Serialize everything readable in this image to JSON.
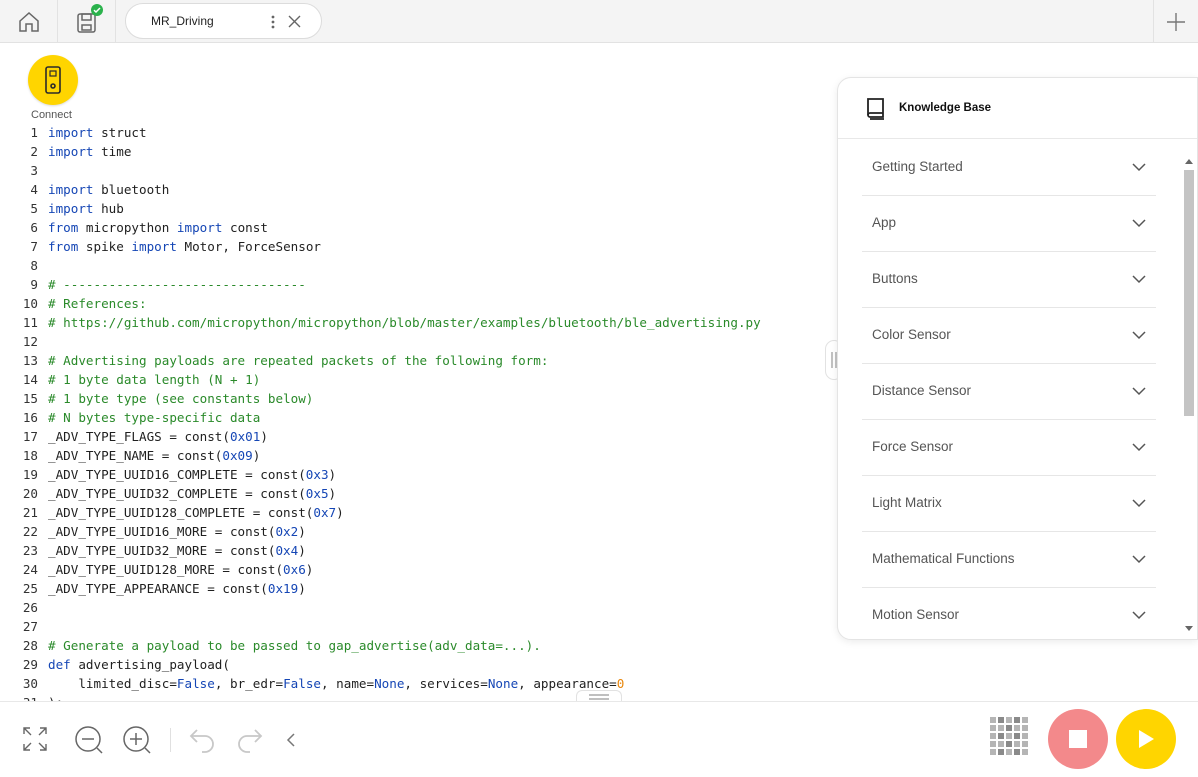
{
  "tab": {
    "title": "MR_Driving"
  },
  "connect": {
    "label": "Connect"
  },
  "code_lines": [
    [
      {
        "t": "import",
        "c": "kw"
      },
      {
        "t": " struct"
      }
    ],
    [
      {
        "t": "import",
        "c": "kw"
      },
      {
        "t": " time"
      }
    ],
    [],
    [
      {
        "t": "import",
        "c": "kw"
      },
      {
        "t": " bluetooth"
      }
    ],
    [
      {
        "t": "import",
        "c": "kw"
      },
      {
        "t": " hub"
      }
    ],
    [
      {
        "t": "from",
        "c": "kw"
      },
      {
        "t": " micropython "
      },
      {
        "t": "import",
        "c": "kw"
      },
      {
        "t": " const"
      }
    ],
    [
      {
        "t": "from",
        "c": "kw"
      },
      {
        "t": " spike "
      },
      {
        "t": "import",
        "c": "kw"
      },
      {
        "t": " Motor, ForceSensor"
      }
    ],
    [],
    [
      {
        "t": "# --------------------------------",
        "c": "cm"
      }
    ],
    [
      {
        "t": "# References:",
        "c": "cm"
      }
    ],
    [
      {
        "t": "# https://github.com/micropython/micropython/blob/master/examples/bluetooth/ble_advertising.py",
        "c": "cm"
      }
    ],
    [],
    [
      {
        "t": "# Advertising payloads are repeated packets of the following form:",
        "c": "cm"
      }
    ],
    [
      {
        "t": "# 1 byte data length (N + 1)",
        "c": "cm"
      }
    ],
    [
      {
        "t": "# 1 byte type (see constants below)",
        "c": "cm"
      }
    ],
    [
      {
        "t": "# N bytes type-specific data",
        "c": "cm"
      }
    ],
    [
      {
        "t": "_ADV_TYPE_FLAGS = const("
      },
      {
        "t": "0x01",
        "c": "num"
      },
      {
        "t": ")"
      }
    ],
    [
      {
        "t": "_ADV_TYPE_NAME = const("
      },
      {
        "t": "0x09",
        "c": "num"
      },
      {
        "t": ")"
      }
    ],
    [
      {
        "t": "_ADV_TYPE_UUID16_COMPLETE = const("
      },
      {
        "t": "0x3",
        "c": "num"
      },
      {
        "t": ")"
      }
    ],
    [
      {
        "t": "_ADV_TYPE_UUID32_COMPLETE = const("
      },
      {
        "t": "0x5",
        "c": "num"
      },
      {
        "t": ")"
      }
    ],
    [
      {
        "t": "_ADV_TYPE_UUID128_COMPLETE = const("
      },
      {
        "t": "0x7",
        "c": "num"
      },
      {
        "t": ")"
      }
    ],
    [
      {
        "t": "_ADV_TYPE_UUID16_MORE = const("
      },
      {
        "t": "0x2",
        "c": "num"
      },
      {
        "t": ")"
      }
    ],
    [
      {
        "t": "_ADV_TYPE_UUID32_MORE = const("
      },
      {
        "t": "0x4",
        "c": "num"
      },
      {
        "t": ")"
      }
    ],
    [
      {
        "t": "_ADV_TYPE_UUID128_MORE = const("
      },
      {
        "t": "0x6",
        "c": "num"
      },
      {
        "t": ")"
      }
    ],
    [
      {
        "t": "_ADV_TYPE_APPEARANCE = const("
      },
      {
        "t": "0x19",
        "c": "num"
      },
      {
        "t": ")"
      }
    ],
    [],
    [],
    [
      {
        "t": "# Generate a payload to be passed to gap_advertise(adv_data=...).",
        "c": "cm"
      }
    ],
    [
      {
        "t": "def",
        "c": "kw"
      },
      {
        "t": " advertising_payload("
      }
    ],
    [
      {
        "t": "    limited_disc="
      },
      {
        "t": "False",
        "c": "kw"
      },
      {
        "t": ", br_edr="
      },
      {
        "t": "False",
        "c": "kw"
      },
      {
        "t": ", name="
      },
      {
        "t": "None",
        "c": "kw"
      },
      {
        "t": ", services="
      },
      {
        "t": "None",
        "c": "kw"
      },
      {
        "t": ", appearance="
      },
      {
        "t": "0",
        "c": "num0"
      }
    ],
    [
      {
        "t": "):"
      }
    ]
  ],
  "knowledge_base": {
    "title": "Knowledge Base",
    "items": [
      "Getting Started",
      "App",
      "Buttons",
      "Color Sensor",
      "Distance Sensor",
      "Force Sensor",
      "Light Matrix",
      "Mathematical Functions",
      "Motion Sensor"
    ]
  },
  "colors": {
    "accent_yellow": "#ffd500",
    "stop_red": "#f3898b",
    "keyword_blue": "#1546b5",
    "comment_green": "#2a8a2a",
    "number_orange": "#e8870d"
  },
  "icons": {
    "home": "home-icon",
    "save": "save-icon",
    "save_status": "check-badge-icon",
    "tab_menu": "kebab-menu-icon",
    "tab_close": "close-icon",
    "new_tab": "plus-icon",
    "connect": "hub-device-icon",
    "kb": "book-icon",
    "fullscreen": "fullscreen-icon",
    "zoom_out": "zoom-out-icon",
    "zoom_in": "zoom-in-icon",
    "undo": "undo-icon",
    "redo": "redo-icon",
    "collapse": "chevron-left-icon",
    "stop": "stop-icon",
    "play": "play-icon"
  }
}
